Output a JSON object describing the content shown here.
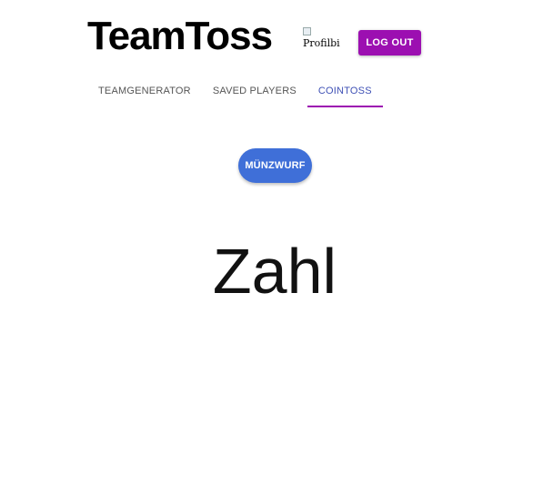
{
  "header": {
    "title": "TeamToss",
    "profile_image_alt": "Profilbi",
    "logout_label": "LOG OUT"
  },
  "tabs": [
    {
      "label": "TEAMGENERATOR",
      "active": false
    },
    {
      "label": "SAVED PLAYERS",
      "active": false
    },
    {
      "label": "COINTOSS",
      "active": true
    }
  ],
  "main": {
    "coin_button_label": "MÜNZWURF",
    "result_text": "Zahl"
  },
  "colors": {
    "accent_purple": "#9c0fb1",
    "active_tab_text": "#3f51b5",
    "coin_button_blue": "#3f6fd8"
  }
}
